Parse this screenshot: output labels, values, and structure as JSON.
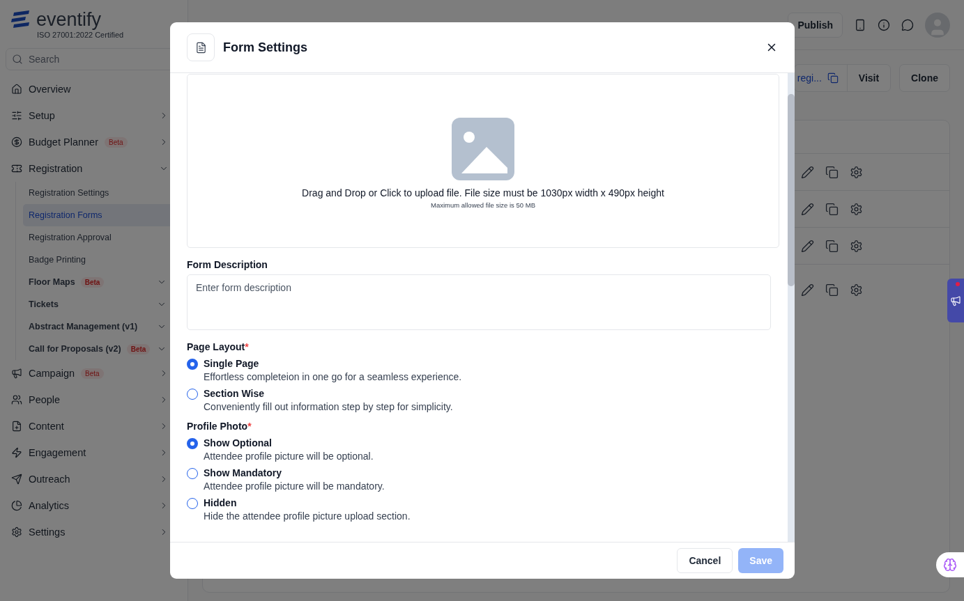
{
  "sidebar": {
    "logo": {
      "name": "eventify",
      "tagline": "ISO 27001:2022 Certified"
    },
    "search": {
      "placeholder": "Search"
    },
    "items": [
      {
        "label": "Overview",
        "selected": false
      },
      {
        "label": "Setup",
        "selected": false,
        "expanded": false
      },
      {
        "label": "Budget Planner",
        "badge": "Beta",
        "selected": false,
        "expanded": false
      },
      {
        "label": "Registration",
        "selected": false,
        "expanded": true,
        "children": [
          {
            "label": "Registration Settings",
            "kind": "link",
            "selected": false
          },
          {
            "label": "Registration Forms",
            "kind": "link",
            "selected": true
          },
          {
            "label": "Registration Approval",
            "kind": "link",
            "selected": false
          },
          {
            "label": "Badge Printing",
            "kind": "link",
            "selected": false
          },
          {
            "label": "Floor Maps",
            "badge": "Beta",
            "kind": "group",
            "selected": false
          },
          {
            "label": "Tickets",
            "kind": "group",
            "selected": false
          },
          {
            "label": "Abstract Management (v1)",
            "kind": "group",
            "selected": false
          },
          {
            "label": "Call for Proposals (v2)",
            "badge": "Beta",
            "kind": "group",
            "selected": false
          }
        ]
      },
      {
        "label": "Campaign",
        "badge": "Beta",
        "selected": false,
        "expanded": false
      },
      {
        "label": "People",
        "selected": false,
        "expanded": false
      },
      {
        "label": "Content",
        "selected": false,
        "expanded": false
      },
      {
        "label": "Engagement",
        "selected": false,
        "expanded": false
      },
      {
        "label": "Outreach",
        "selected": false,
        "expanded": false
      },
      {
        "label": "Analytics",
        "selected": false,
        "expanded": false
      },
      {
        "label": "Settings",
        "selected": false,
        "expanded": false
      }
    ]
  },
  "topbar": {
    "publish": "Publish"
  },
  "actions": {
    "link": "regi...",
    "visit": "Visit",
    "clone": "Clone"
  },
  "modal": {
    "title": "Form Settings",
    "upload": {
      "text": "Drag and Drop or Click to upload file. File size must be 1030px width x 490px height",
      "note": "Maximum allowed file size is 50 MB"
    },
    "description": {
      "label": "Form Description",
      "placeholder": "Enter form description"
    },
    "groups": [
      {
        "label": "Page Layout",
        "required_mark": "*",
        "options": [
          {
            "label": "Single Page",
            "description": "Effortless completeion in one go for a seamless experience.",
            "selected": true
          },
          {
            "label": "Section Wise",
            "description": "Conveniently fill out information step by step for simplicity.",
            "selected": false
          }
        ]
      },
      {
        "label": "Profile Photo",
        "required_mark": "*",
        "options": [
          {
            "label": "Show Optional",
            "description": "Attendee profile picture will be optional.",
            "selected": true
          },
          {
            "label": "Show Mandatory",
            "description": "Attendee profile picture will be mandatory.",
            "selected": false
          },
          {
            "label": "Hidden",
            "description": "Hide the attendee profile picture upload section.",
            "selected": false
          }
        ]
      }
    ],
    "cancel": "Cancel",
    "save": {
      "label": "Save",
      "disabled": true
    }
  }
}
